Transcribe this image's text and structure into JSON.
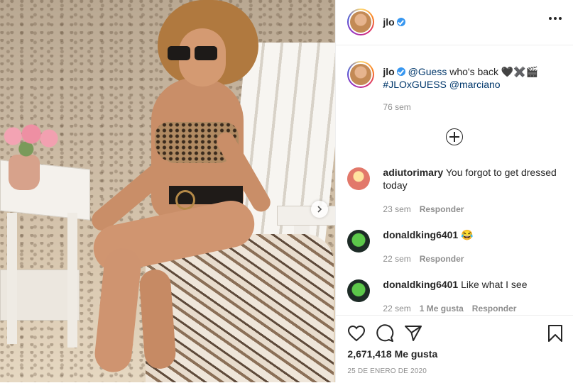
{
  "post": {
    "author": "jlo",
    "caption_mention": "@Guess",
    "caption_text": " who's back 🖤✖️🎬",
    "caption_hashtag": "#JLOxGUESS",
    "caption_mention2": "@marciano",
    "caption_age": "76 sem"
  },
  "comments": [
    {
      "user": "adiutorimary",
      "text": "You forgot to get dressed today",
      "age": "23 sem",
      "likes": "",
      "reply": "Responder"
    },
    {
      "user": "donaldking6401",
      "text": "😂",
      "age": "22 sem",
      "likes": "",
      "reply": "Responder"
    },
    {
      "user": "donaldking6401",
      "text": "Like what I see",
      "age": "22 sem",
      "likes": "1 Me gusta",
      "reply": "Responder"
    }
  ],
  "footer": {
    "likes_count": "2,671,418 Me gusta",
    "date": "25 DE ENERO DE 2020"
  },
  "icons": [
    "heart-icon",
    "comment-icon",
    "share-icon",
    "bookmark-icon",
    "more-options-icon",
    "next-arrow-icon",
    "verified-badge-icon",
    "load-more-icon"
  ],
  "colors": {
    "link": "#00376b",
    "verified": "#3897f0",
    "meta": "#8e8e8e"
  }
}
